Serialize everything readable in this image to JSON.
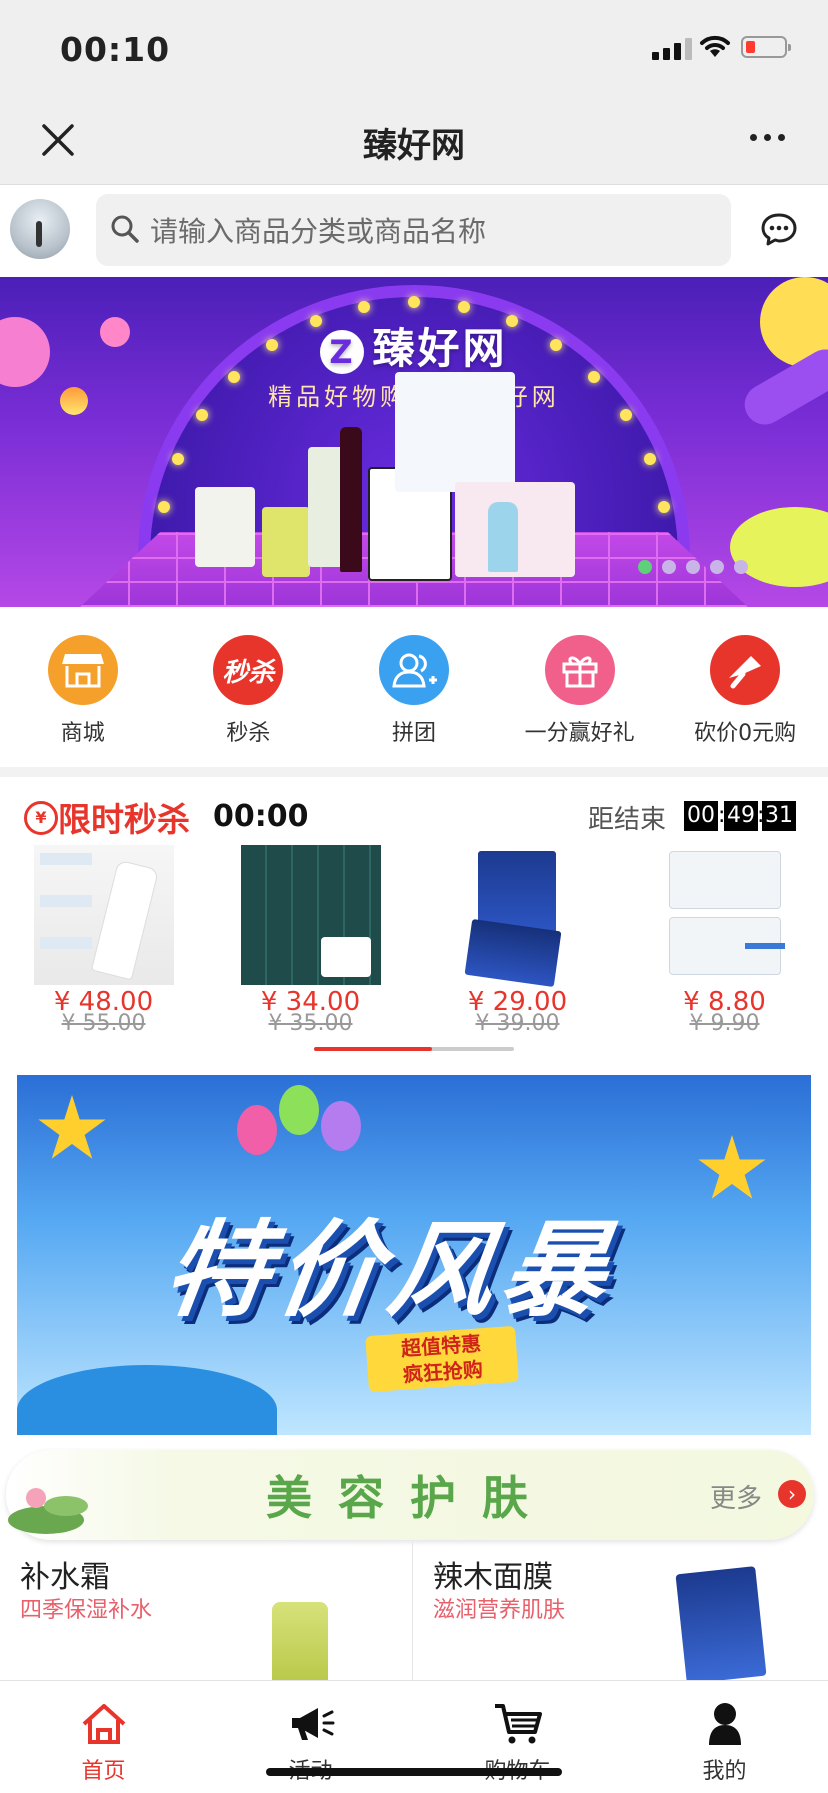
{
  "status": {
    "time": "00:10"
  },
  "nav": {
    "title": "臻好网"
  },
  "search": {
    "placeholder": "请输入商品分类或商品名称"
  },
  "banner": {
    "brand": "臻好网",
    "slogan": "精品好物购 尽在臻好网",
    "active_dot": 0,
    "dot_count": 5
  },
  "categories": [
    {
      "label": "商城",
      "icon": "store-icon",
      "color": "#f5a02a"
    },
    {
      "label": "秒杀",
      "icon": "flash-sale-icon",
      "color": "#e8352c"
    },
    {
      "label": "拼团",
      "icon": "group-buy-icon",
      "color": "#3aa0f0"
    },
    {
      "label": "一分赢好礼",
      "icon": "gift-icon",
      "color": "#f0608a"
    },
    {
      "label": "砍价0元购",
      "icon": "bargain-knife-icon",
      "color": "#e8352c"
    }
  ],
  "flash_sale": {
    "title": "限时秒杀",
    "session": "00:00",
    "ends_label": "距结束",
    "countdown": {
      "h": "00",
      "m": "49",
      "s": "31"
    },
    "items": [
      {
        "price": "¥ 48.00",
        "old_price": "¥ 55.00"
      },
      {
        "price": "¥ 34.00",
        "old_price": "¥ 35.00"
      },
      {
        "price": "¥ 29.00",
        "old_price": "¥ 39.00"
      },
      {
        "price": "¥ 8.80",
        "old_price": "¥ 9.90"
      }
    ],
    "scroll_progress": 0.59
  },
  "promo": {
    "headline": "特价风暴",
    "tag1": "超值特惠",
    "tag2": "疯狂抢购"
  },
  "beauty": {
    "title": "美容护肤",
    "more": "更多"
  },
  "goods": [
    {
      "name": "补水霜",
      "desc": "四季保湿补水"
    },
    {
      "name": "辣木面膜",
      "desc": "滋润营养肌肤"
    }
  ],
  "tabbar": [
    {
      "label": "首页",
      "icon": "home-icon",
      "active": true
    },
    {
      "label": "活动",
      "icon": "megaphone-icon",
      "active": false
    },
    {
      "label": "购物车",
      "icon": "cart-icon",
      "active": false
    },
    {
      "label": "我的",
      "icon": "user-icon",
      "active": false
    }
  ],
  "colors": {
    "accent": "#e8352c",
    "green": "#5aa64a"
  }
}
